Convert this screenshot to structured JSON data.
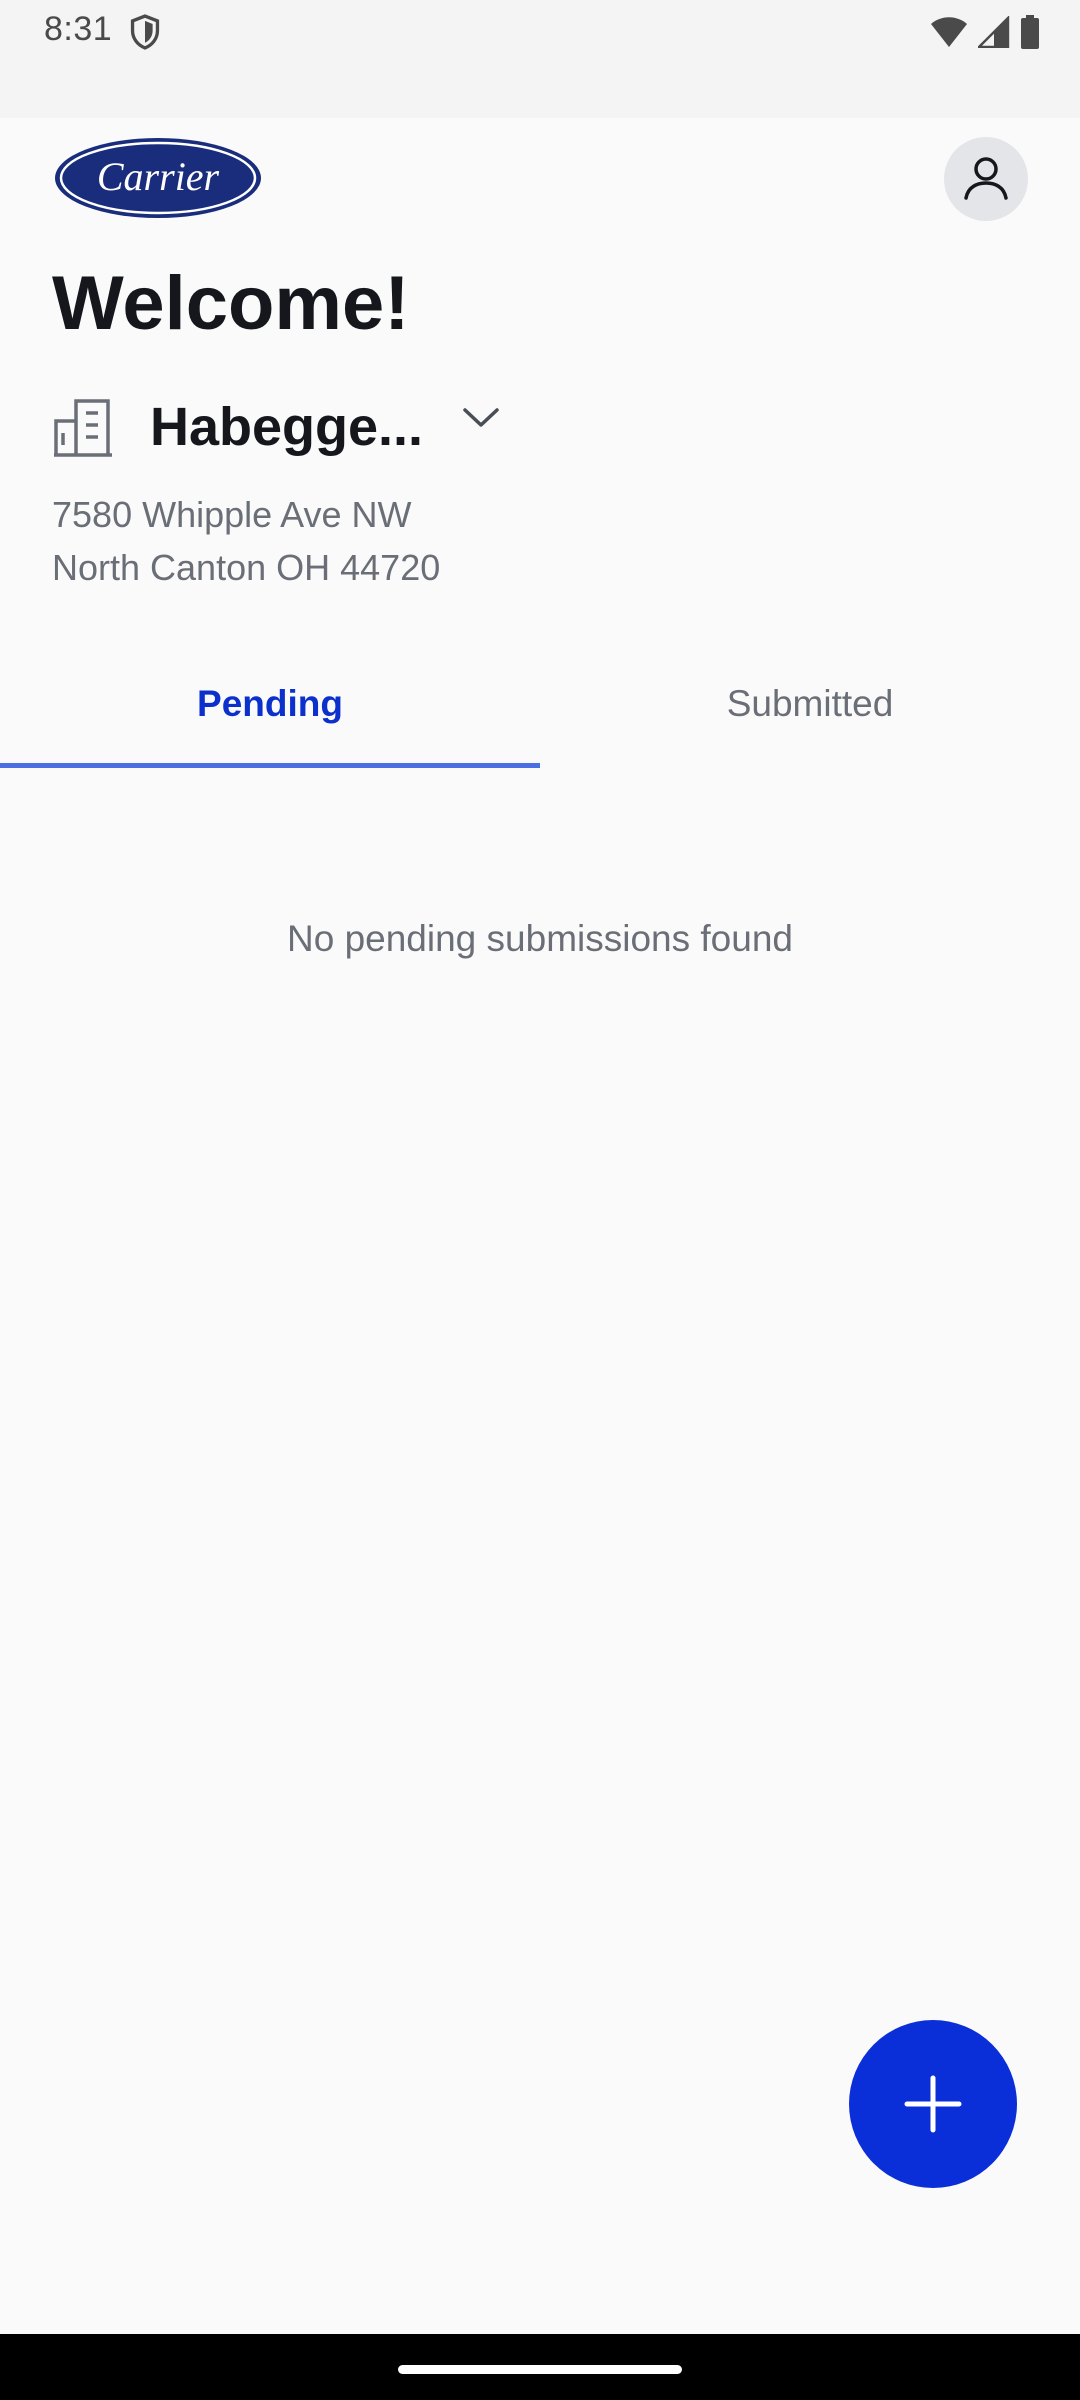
{
  "status_bar": {
    "time": "8:31"
  },
  "header": {
    "logo_text": "Carrier"
  },
  "welcome": "Welcome!",
  "site": {
    "name": "Habegge...",
    "address_line1": "7580 Whipple Ave NW",
    "address_line2": "North Canton OH 44720"
  },
  "tabs": [
    {
      "label": "Pending",
      "active": true
    },
    {
      "label": "Submitted",
      "active": false
    }
  ],
  "empty_state": "No pending submissions found",
  "icons": {
    "status_shield": "shield-icon",
    "wifi": "wifi-icon",
    "signal": "signal-icon",
    "battery": "battery-icon",
    "profile": "person-icon",
    "building": "building-icon",
    "dropdown": "chevron-down-icon",
    "fab": "plus-icon"
  },
  "colors": {
    "accent": "#0a2fd9",
    "active_tab": "#0b30cc",
    "tab_indicator": "#4a6fe0",
    "logo_blue": "#1a2d7c",
    "text_primary": "#15171c",
    "text_secondary": "#6a6e76",
    "background": "#fafafa"
  }
}
